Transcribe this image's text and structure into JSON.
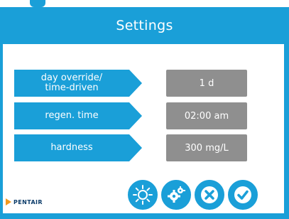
{
  "header": {
    "title": "Settings"
  },
  "rows": [
    {
      "label": "day override/\ntime-driven",
      "value": "1 d"
    },
    {
      "label": "regen. time",
      "value": "02:00 am"
    },
    {
      "label": "hardness",
      "value": "300 mg/L"
    }
  ],
  "footer": {
    "logo_text": "PENTAIR"
  },
  "colors": {
    "primary": "#1a9fd8",
    "value_box": "#8f8f8f",
    "logo_orange": "#f39a1e",
    "logo_navy": "#0b3b69"
  },
  "actions": [
    {
      "name": "sun-icon"
    },
    {
      "name": "gears-icon"
    },
    {
      "name": "close-icon"
    },
    {
      "name": "check-icon"
    }
  ]
}
